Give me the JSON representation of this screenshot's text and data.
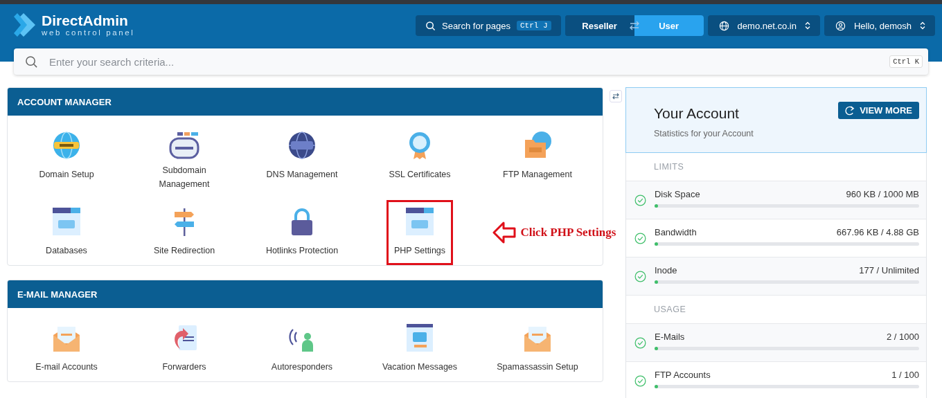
{
  "brand": {
    "name": "DirectAdmin",
    "tagline": "web control panel"
  },
  "top_search": {
    "label": "Search for pages",
    "shortcut": "Ctrl J"
  },
  "level_switch": [
    {
      "label": "Reseller",
      "selected": false
    },
    {
      "label": "User",
      "selected": true
    }
  ],
  "domain_select": {
    "value": "demo.net.co.in"
  },
  "user_menu": {
    "label": "Hello, demosh"
  },
  "search": {
    "placeholder": "Enter your search criteria...",
    "shortcut": "Ctrl K"
  },
  "sections": [
    {
      "title": "ACCOUNT MANAGER",
      "items": [
        {
          "label": "Domain Setup",
          "highlighted": false
        },
        {
          "label": "Subdomain Management",
          "highlighted": false
        },
        {
          "label": "DNS Management",
          "highlighted": false
        },
        {
          "label": "SSL Certificates",
          "highlighted": false
        },
        {
          "label": "FTP Management",
          "highlighted": false
        },
        {
          "label": "Databases",
          "highlighted": false
        },
        {
          "label": "Site Redirection",
          "highlighted": false
        },
        {
          "label": "Hotlinks Protection",
          "highlighted": false
        },
        {
          "label": "PHP Settings",
          "highlighted": true
        }
      ]
    },
    {
      "title": "E-MAIL MANAGER",
      "items": [
        {
          "label": "E-mail Accounts",
          "highlighted": false
        },
        {
          "label": "Forwarders",
          "highlighted": false
        },
        {
          "label": "Autoresponders",
          "highlighted": false
        },
        {
          "label": "Vacation Messages",
          "highlighted": false
        },
        {
          "label": "Spamassassin Setup",
          "highlighted": false
        }
      ]
    }
  ],
  "annotation": {
    "text": "Click PHP Settings"
  },
  "account": {
    "title": "Your Account",
    "subtitle": "Statistics for your Account",
    "button": "VIEW MORE",
    "groups": [
      {
        "heading": "LIMITS",
        "stats": [
          {
            "name": "Disk Space",
            "reading": "960 KB / 1000 MB",
            "level": 0.005,
            "ok": true
          },
          {
            "name": "Bandwidth",
            "reading": "667.96 KB / 4.88 GB",
            "level": 0.005,
            "ok": true
          },
          {
            "name": "Inode",
            "reading": "177 / Unlimited",
            "level": 0.005,
            "ok": true
          }
        ]
      },
      {
        "heading": "USAGE",
        "stats": [
          {
            "name": "E-Mails",
            "reading": "2 / 1000",
            "level": 0.005,
            "ok": true
          },
          {
            "name": "FTP Accounts",
            "reading": "1 / 100",
            "level": 0.01,
            "ok": true
          }
        ]
      }
    ]
  }
}
